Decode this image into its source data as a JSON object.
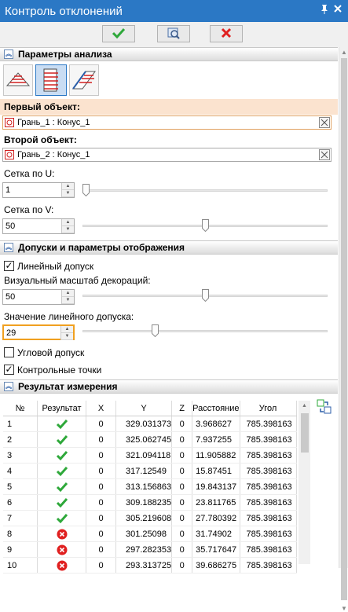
{
  "window": {
    "title": "Контроль отклонений",
    "pin_icon": "pin-icon",
    "close_icon": "close-icon"
  },
  "toolbar": {
    "ok_icon": "checkmark-icon",
    "preview_icon": "preview-icon",
    "cancel_icon": "cancel-icon"
  },
  "analysis": {
    "header": "Параметры анализа",
    "first_object_label": "Первый объект:",
    "first_object_value": "Грань_1 : Конус_1",
    "second_object_label": "Второй объект:",
    "second_object_value": "Грань_2 : Конус_1",
    "grid_u_label": "Сетка по U:",
    "grid_u_value": "1",
    "grid_u_level": 0.0,
    "grid_v_label": "Сетка по V:",
    "grid_v_value": "50",
    "grid_v_level": 0.5
  },
  "tolerances": {
    "header": "Допуски и параметры отображения",
    "linear_tolerance_label": "Линейный допуск",
    "linear_tolerance_checked": true,
    "scale_label": "Визуальный масштаб декораций:",
    "scale_value": "50",
    "scale_level": 0.5,
    "linear_value_label": "Значение линейного допуска:",
    "linear_value": "29",
    "linear_value_level": 0.29,
    "angular_tolerance_label": "Угловой допуск",
    "angular_tolerance_checked": false,
    "control_points_label": "Контрольные точки",
    "control_points_checked": true
  },
  "results": {
    "header": "Результат измерения",
    "columns": [
      "№",
      "Результат",
      "X",
      "Y",
      "Z",
      "Расстояние",
      "Угол"
    ],
    "rows": [
      {
        "n": "1",
        "ok": true,
        "x": "0",
        "y": "329.031373",
        "z": "0",
        "dist": "3.968627",
        "angle": "785.398163"
      },
      {
        "n": "2",
        "ok": true,
        "x": "0",
        "y": "325.062745",
        "z": "0",
        "dist": "7.937255",
        "angle": "785.398163"
      },
      {
        "n": "3",
        "ok": true,
        "x": "0",
        "y": "321.094118",
        "z": "0",
        "dist": "11.905882",
        "angle": "785.398163"
      },
      {
        "n": "4",
        "ok": true,
        "x": "0",
        "y": "317.12549",
        "z": "0",
        "dist": "15.87451",
        "angle": "785.398163"
      },
      {
        "n": "5",
        "ok": true,
        "x": "0",
        "y": "313.156863",
        "z": "0",
        "dist": "19.843137",
        "angle": "785.398163"
      },
      {
        "n": "6",
        "ok": true,
        "x": "0",
        "y": "309.188235",
        "z": "0",
        "dist": "23.811765",
        "angle": "785.398163"
      },
      {
        "n": "7",
        "ok": true,
        "x": "0",
        "y": "305.219608",
        "z": "0",
        "dist": "27.780392",
        "angle": "785.398163"
      },
      {
        "n": "8",
        "ok": false,
        "x": "0",
        "y": "301.25098",
        "z": "0",
        "dist": "31.74902",
        "angle": "785.398163"
      },
      {
        "n": "9",
        "ok": false,
        "x": "0",
        "y": "297.282353",
        "z": "0",
        "dist": "35.717647",
        "angle": "785.398163"
      },
      {
        "n": "10",
        "ok": false,
        "x": "0",
        "y": "293.313725",
        "z": "0",
        "dist": "39.686275",
        "angle": "785.398163"
      }
    ]
  },
  "colors": {
    "title_bar": "#2b78c5",
    "ok_green": "#2ea83a",
    "error_red": "#e02020",
    "focus_orange": "#f0a020",
    "selected_row": "#fbe3cf"
  }
}
